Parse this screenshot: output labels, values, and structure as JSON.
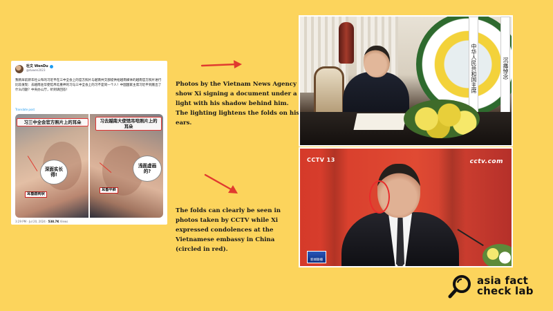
{
  "tweet": {
    "author_name": "杜文 WenDu",
    "author_handle": "@duwen2023",
    "body": "我稍早前新华社公布的习近平在三中全会上的官方照片与越南共交部提供给越南媒体的越南官方照片进行比较发现：去越南驻华使馆吊唁重神的习与三中全会上的习不是同一个人！中国国家主席习近平到底出了什么问题？中央办公厅，听到请回答！",
    "translate_label": "Translate post",
    "image_left": {
      "caption": "习三中全会官方照片上的耳朵",
      "bubble": "深面实长得!",
      "tag": "耳垂圆钩状"
    },
    "image_right": {
      "caption": "习去越南大使馆吊唁照片上的耳朵",
      "bubble": "浅面虚画的?",
      "tag": "耳垂平斜"
    },
    "time": "3:29 PM · Jul 20, 2024",
    "views_count": "538.7K",
    "views_label": "Views"
  },
  "captions": {
    "top": "Photos by the Vietnam News Agency show Xi signing a document under a light with his shadow behind him. The lighting lightens the folds on his ears.",
    "bottom": "The folds can clearly be seen in photos taken by CCTV while Xi expressed condolences at the Vietnamese embassy in China (circled in red)."
  },
  "photo_top": {
    "ribbon_left": "中华人民共和国主席",
    "ribbon_right": "沉痛悼念"
  },
  "photo_bottom": {
    "logo_left": "CCTV 13",
    "logo_right": "cctv.com",
    "news_badge": "新闻联播"
  },
  "brand": {
    "line1": "asia fact",
    "line2": "check lab"
  },
  "colors": {
    "background": "#fcd45c",
    "arrow": "#e03a2f",
    "circle": "#e82c2c"
  }
}
